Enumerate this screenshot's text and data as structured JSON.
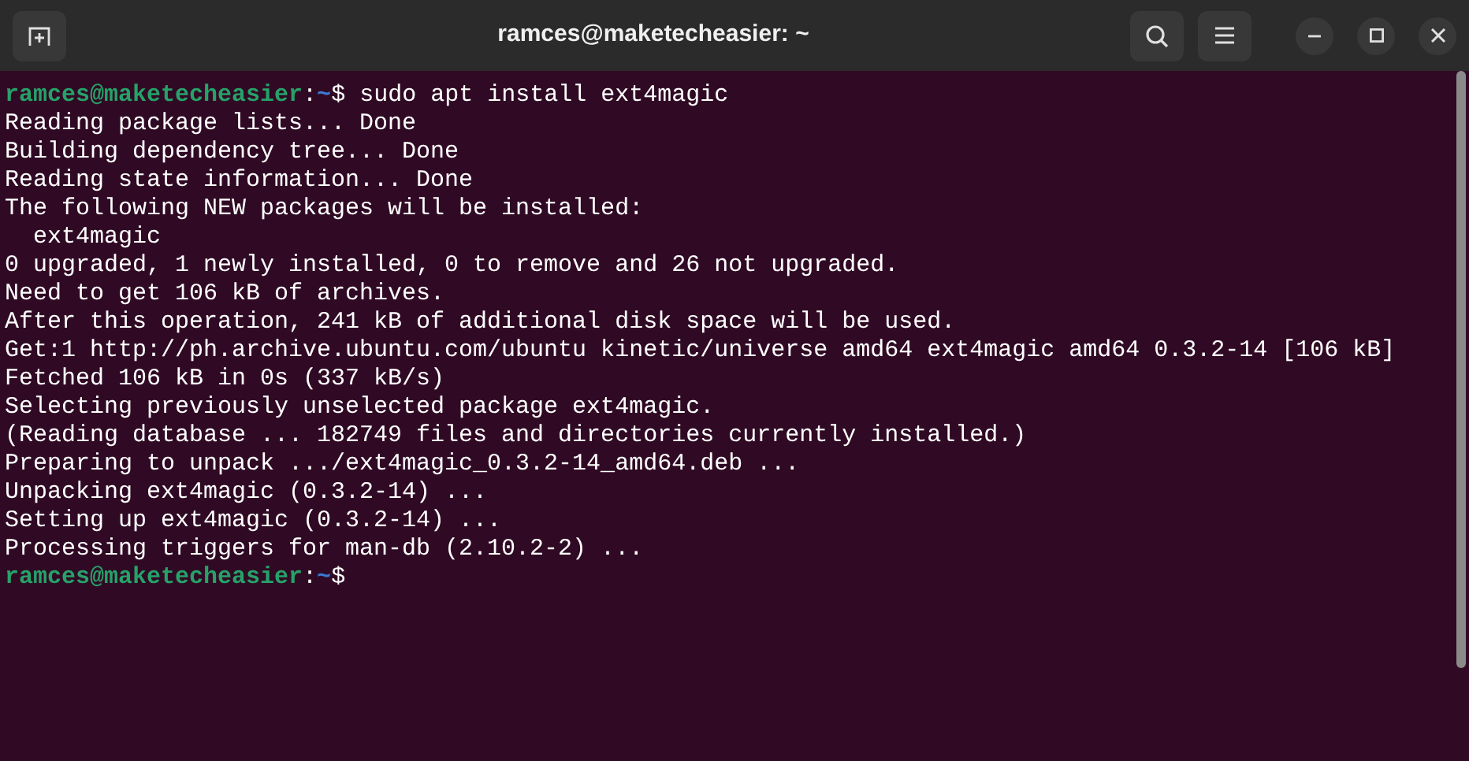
{
  "window": {
    "title": "ramces@maketecheasier: ~"
  },
  "lines": [
    {
      "kind": "prompt",
      "user": "ramces@maketecheasier",
      "separator": ":",
      "path": "~",
      "symbol": "$",
      "command": "sudo apt install ext4magic"
    },
    {
      "kind": "output",
      "text": "Reading package lists... Done"
    },
    {
      "kind": "output",
      "text": "Building dependency tree... Done"
    },
    {
      "kind": "output",
      "text": "Reading state information... Done"
    },
    {
      "kind": "output",
      "text": "The following NEW packages will be installed:"
    },
    {
      "kind": "output",
      "text": "  ext4magic"
    },
    {
      "kind": "output",
      "text": "0 upgraded, 1 newly installed, 0 to remove and 26 not upgraded."
    },
    {
      "kind": "output",
      "text": "Need to get 106 kB of archives."
    },
    {
      "kind": "output",
      "text": "After this operation, 241 kB of additional disk space will be used."
    },
    {
      "kind": "output",
      "text": "Get:1 http://ph.archive.ubuntu.com/ubuntu kinetic/universe amd64 ext4magic amd64 0.3.2-14 [106 kB]"
    },
    {
      "kind": "output",
      "text": "Fetched 106 kB in 0s (337 kB/s)"
    },
    {
      "kind": "output",
      "text": "Selecting previously unselected package ext4magic."
    },
    {
      "kind": "output",
      "text": "(Reading database ... 182749 files and directories currently installed.)"
    },
    {
      "kind": "output",
      "text": "Preparing to unpack .../ext4magic_0.3.2-14_amd64.deb ..."
    },
    {
      "kind": "output",
      "text": "Unpacking ext4magic (0.3.2-14) ..."
    },
    {
      "kind": "output",
      "text": "Setting up ext4magic (0.3.2-14) ..."
    },
    {
      "kind": "output",
      "text": "Processing triggers for man-db (2.10.2-2) ..."
    },
    {
      "kind": "prompt",
      "user": "ramces@maketecheasier",
      "separator": ":",
      "path": "~",
      "symbol": "$"
    }
  ]
}
